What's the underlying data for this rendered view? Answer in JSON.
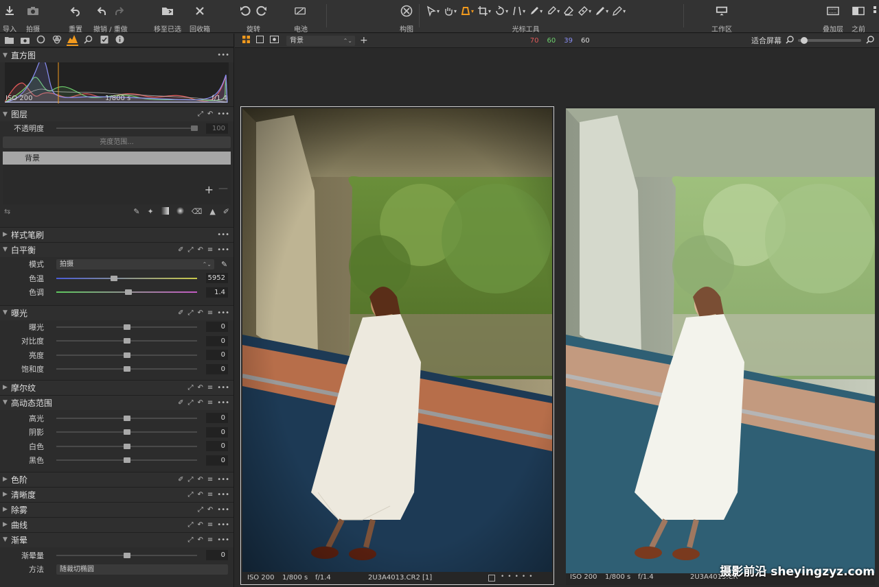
{
  "toolbar": {
    "import": "导入",
    "capture": "拍摄",
    "reset": "重置",
    "undo_redo": "撤销 / 重做",
    "move_to_selected": "移至已选",
    "trash": "回收箱",
    "rotate": "旋转",
    "battery": "电池",
    "composition": "构图",
    "cursor_tools": "光标工具",
    "workspace": "工作区",
    "overlay": "叠加层",
    "before": "之前"
  },
  "left_panel": {
    "tabs": [
      "folder-icon",
      "camera-icon",
      "circle-icon",
      "color-icon",
      "exposure-icon",
      "search-icon",
      "check-icon",
      "info-icon"
    ],
    "histogram": {
      "title": "直方图",
      "iso": "ISO 200",
      "shutter": "1/800 s",
      "aperture": "f/1.4"
    },
    "layers": {
      "title": "图层",
      "opacity_label": "不透明度",
      "opacity_value": "100",
      "luma_range": "亮度范围...",
      "layer_name": "背景"
    },
    "style_brush": "样式笔刷",
    "white_balance": {
      "title": "白平衡",
      "mode_label": "模式",
      "mode_value": "拍摄",
      "temp_label": "色温",
      "temp_value": "5952",
      "temp_pos": 0.41,
      "tint_label": "色调",
      "tint_value": "1.4",
      "tint_pos": 0.51
    },
    "exposure": {
      "title": "曝光",
      "rows": [
        {
          "label": "曝光",
          "value": "0",
          "pos": 0.5
        },
        {
          "label": "对比度",
          "value": "0",
          "pos": 0.5
        },
        {
          "label": "亮度",
          "value": "0",
          "pos": 0.5
        },
        {
          "label": "饱和度",
          "value": "0",
          "pos": 0.5
        }
      ]
    },
    "moire": "摩尔纹",
    "hdr": {
      "title": "高动态范围",
      "rows": [
        {
          "label": "高光",
          "value": "0",
          "pos": 0.5
        },
        {
          "label": "阴影",
          "value": "0",
          "pos": 0.5
        },
        {
          "label": "白色",
          "value": "0",
          "pos": 0.5
        },
        {
          "label": "黑色",
          "value": "0",
          "pos": 0.5
        }
      ]
    },
    "levels": "色阶",
    "clarity": "清晰度",
    "dehaze": "除雾",
    "curve": "曲线",
    "vignette": {
      "title": "渐晕",
      "amount_label": "渐晕量",
      "amount_value": "0",
      "amount_pos": 0.5,
      "method_label": "方法",
      "method_value": "随裁切椭圆"
    }
  },
  "viewer": {
    "layer_select": "背景",
    "cursor_r": "70",
    "cursor_g": "60",
    "cursor_b": "39",
    "cursor_l": "60",
    "fit": "适合屏幕",
    "zoom_pos": 0.1,
    "left_photo": {
      "iso": "ISO 200",
      "shutter": "1/800 s",
      "aperture": "f/1.4",
      "filename": "2U3A4013.CR2 [1]"
    },
    "right_photo": {
      "iso": "ISO 200",
      "shutter": "1/800 s",
      "aperture": "f/1.4",
      "filename": "2U3A4013.CR"
    }
  },
  "watermark": "摄影前沿 sheyingzyz.com",
  "colors": {
    "accent": "#f29a1d",
    "red": "#e05a5a",
    "green": "#6dd06d",
    "blue": "#8a8ff5"
  }
}
